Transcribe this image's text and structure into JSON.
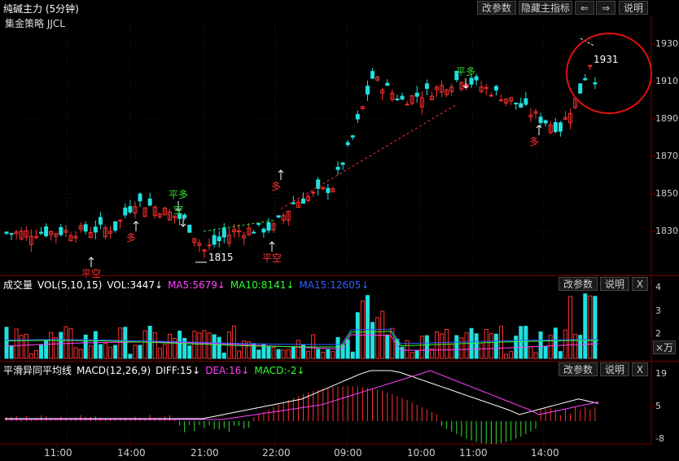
{
  "window": {
    "title": "纯碱主力 (5分钟)",
    "strategy": "集金策略 JJCL",
    "buttons": [
      "改参数",
      "隐藏主指标",
      "⇐",
      "⇒",
      "说明"
    ]
  },
  "main_chart": {
    "price_axis": [
      "1930",
      "1910",
      "1890",
      "1870",
      "1850",
      "1830"
    ],
    "annotations": {
      "low_label": "1815",
      "high_label": "1931",
      "signals": [
        {
          "text": "平空",
          "color": "#ff3030"
        },
        {
          "text": "多",
          "color": "#ff3030"
        },
        {
          "text": "平多",
          "color": "#30e030"
        },
        {
          "text": "空",
          "color": "#30e030"
        },
        {
          "text": "多",
          "color": "#ff3030"
        },
        {
          "text": "平空",
          "color": "#ff3030"
        },
        {
          "text": "平多",
          "color": "#30e030"
        },
        {
          "text": "多",
          "color": "#ff3030"
        }
      ]
    },
    "colors": {
      "up": "#ff3030",
      "down": "#22e0e0",
      "ma": "#ffff00",
      "trend": "#ff3030",
      "circle": "#e01010"
    }
  },
  "volume": {
    "title": "成交量",
    "params": "VOL(5,10,15)",
    "vol": "VOL:3447↓",
    "ma5": "MA5:5679↓",
    "ma10": "MA10:8141↓",
    "ma15": "MA15:12605↓",
    "axis": [
      "4",
      "3",
      "2",
      "1"
    ],
    "unit_btn": "×万",
    "buttons": [
      "改参数",
      "说明",
      "X"
    ]
  },
  "macd": {
    "title": "平滑异同平均线",
    "params": "MACD(12,26,9)",
    "diff": "DIFF:15↓",
    "dea": "DEA:16↓",
    "macd": "MACD:-2↓",
    "axis": [
      "19",
      "5",
      "-8"
    ],
    "buttons": [
      "改参数",
      "说明",
      "X"
    ]
  },
  "time_axis": [
    "11:00",
    "14:00",
    "21:00",
    "22:00",
    "09:00",
    "10:00",
    "11:00",
    "14:00"
  ]
}
